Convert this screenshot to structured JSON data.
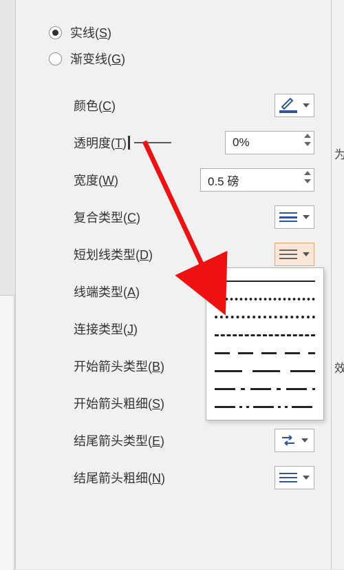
{
  "radios": {
    "solid": {
      "label": "实线",
      "key": "S",
      "checked": true
    },
    "gradient": {
      "label": "渐变线",
      "key": "G",
      "checked": false
    }
  },
  "edge": {
    "t1": "为",
    "t2": "效"
  },
  "props": {
    "color": {
      "label": "颜色",
      "key": "C"
    },
    "transparency": {
      "label": "透明度",
      "key": "T",
      "value": "0%"
    },
    "width": {
      "label": "宽度",
      "key": "W",
      "value": "0.5 磅"
    },
    "compound": {
      "label": "复合类型",
      "key": "C"
    },
    "dash": {
      "label": "短划线类型",
      "key": "D"
    },
    "cap": {
      "label": "线端类型",
      "key": "A"
    },
    "join": {
      "label": "连接类型",
      "key": "J"
    },
    "beginType": {
      "label": "开始箭头类型",
      "key": "B"
    },
    "beginSize": {
      "label": "开始箭头粗细",
      "key": "S"
    },
    "endType": {
      "label": "结尾箭头类型",
      "key": "E"
    },
    "endSize": {
      "label": "结尾箭头粗细",
      "key": "N"
    }
  },
  "colors": {
    "accent": "#2f5596",
    "dashActive": "#fbe5d6"
  }
}
